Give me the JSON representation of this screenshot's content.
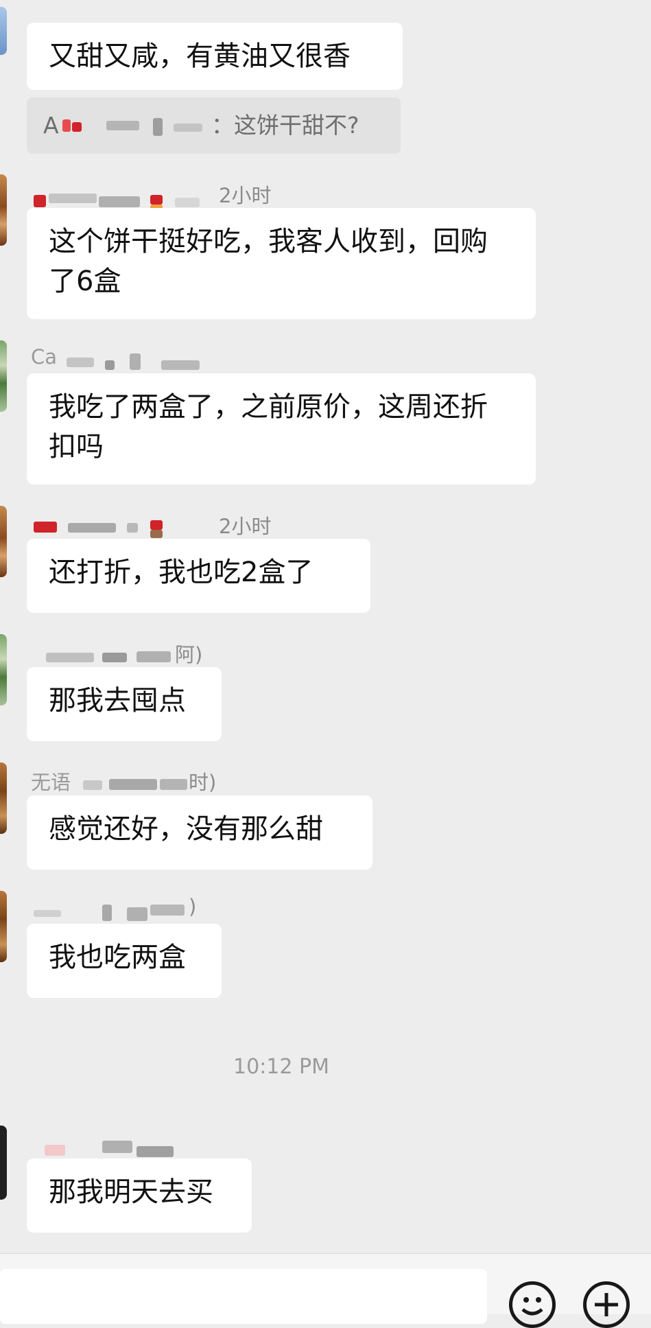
{
  "messages": [
    {
      "text": "又甜又咸，有黄油又很香"
    },
    {
      "quote_prefix": "A",
      "quote_text": "：这饼干甜不?"
    },
    {
      "time_suffix": "2小时",
      "text": "这个饼干挺好吃，我客人收到，回购了6盒"
    },
    {
      "name_visible": "Ca",
      "text": "我吃了两盒了，之前原价，这周还折扣吗"
    },
    {
      "time_suffix": "2小时",
      "text": "还打折，我也吃2盒了"
    },
    {
      "time_suffix": "阿)",
      "text": "那我去囤点"
    },
    {
      "name_prefix": "无语",
      "time_suffix": "时)",
      "text": "感觉还好，没有那么甜"
    },
    {
      "time_suffix": ")",
      "text": "我也吃两盒"
    },
    {
      "text": "那我明天去买"
    }
  ],
  "timestamp": "10:12 PM",
  "toolbar": {
    "emoji_icon": "smile-face-icon",
    "add_icon": "plus-circle-icon"
  },
  "colors": {
    "background": "#ededed",
    "bubble": "#ffffff",
    "quote": "#e2e2e2",
    "redacted_red": "#d0232a"
  }
}
